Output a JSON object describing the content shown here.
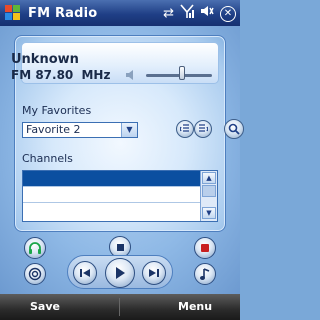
{
  "titlebar": {
    "title": "FM Radio",
    "icons": [
      "windows-logo-icon",
      "connectivity-icon",
      "signal-icon",
      "speaker-icon",
      "close-icon"
    ],
    "close_label": "✕"
  },
  "station": {
    "name": "Unknown",
    "frequency": "FM 87.80",
    "unit": "MHz",
    "volume_level": 0.55
  },
  "favorites": {
    "label": "My Favorites",
    "selected": "Favorite 2",
    "icons": [
      "favorite-list-prev-icon",
      "favorite-list-next-icon",
      "search-icon"
    ]
  },
  "channels": {
    "label": "Channels",
    "rows": [
      "",
      "",
      ""
    ]
  },
  "side_buttons_left": [
    "headphones-icon",
    "speaker-output-icon"
  ],
  "side_buttons_right": [
    "record-icon",
    "music-note-icon"
  ],
  "transport": [
    "stop-icon",
    "previous-icon",
    "play-icon",
    "next-icon"
  ],
  "softkeys": {
    "left": "Save",
    "right": "Menu"
  },
  "colors": {
    "titlebar": "#1f3f86",
    "selection": "#0b4fa0",
    "record": "#c81f1f"
  }
}
